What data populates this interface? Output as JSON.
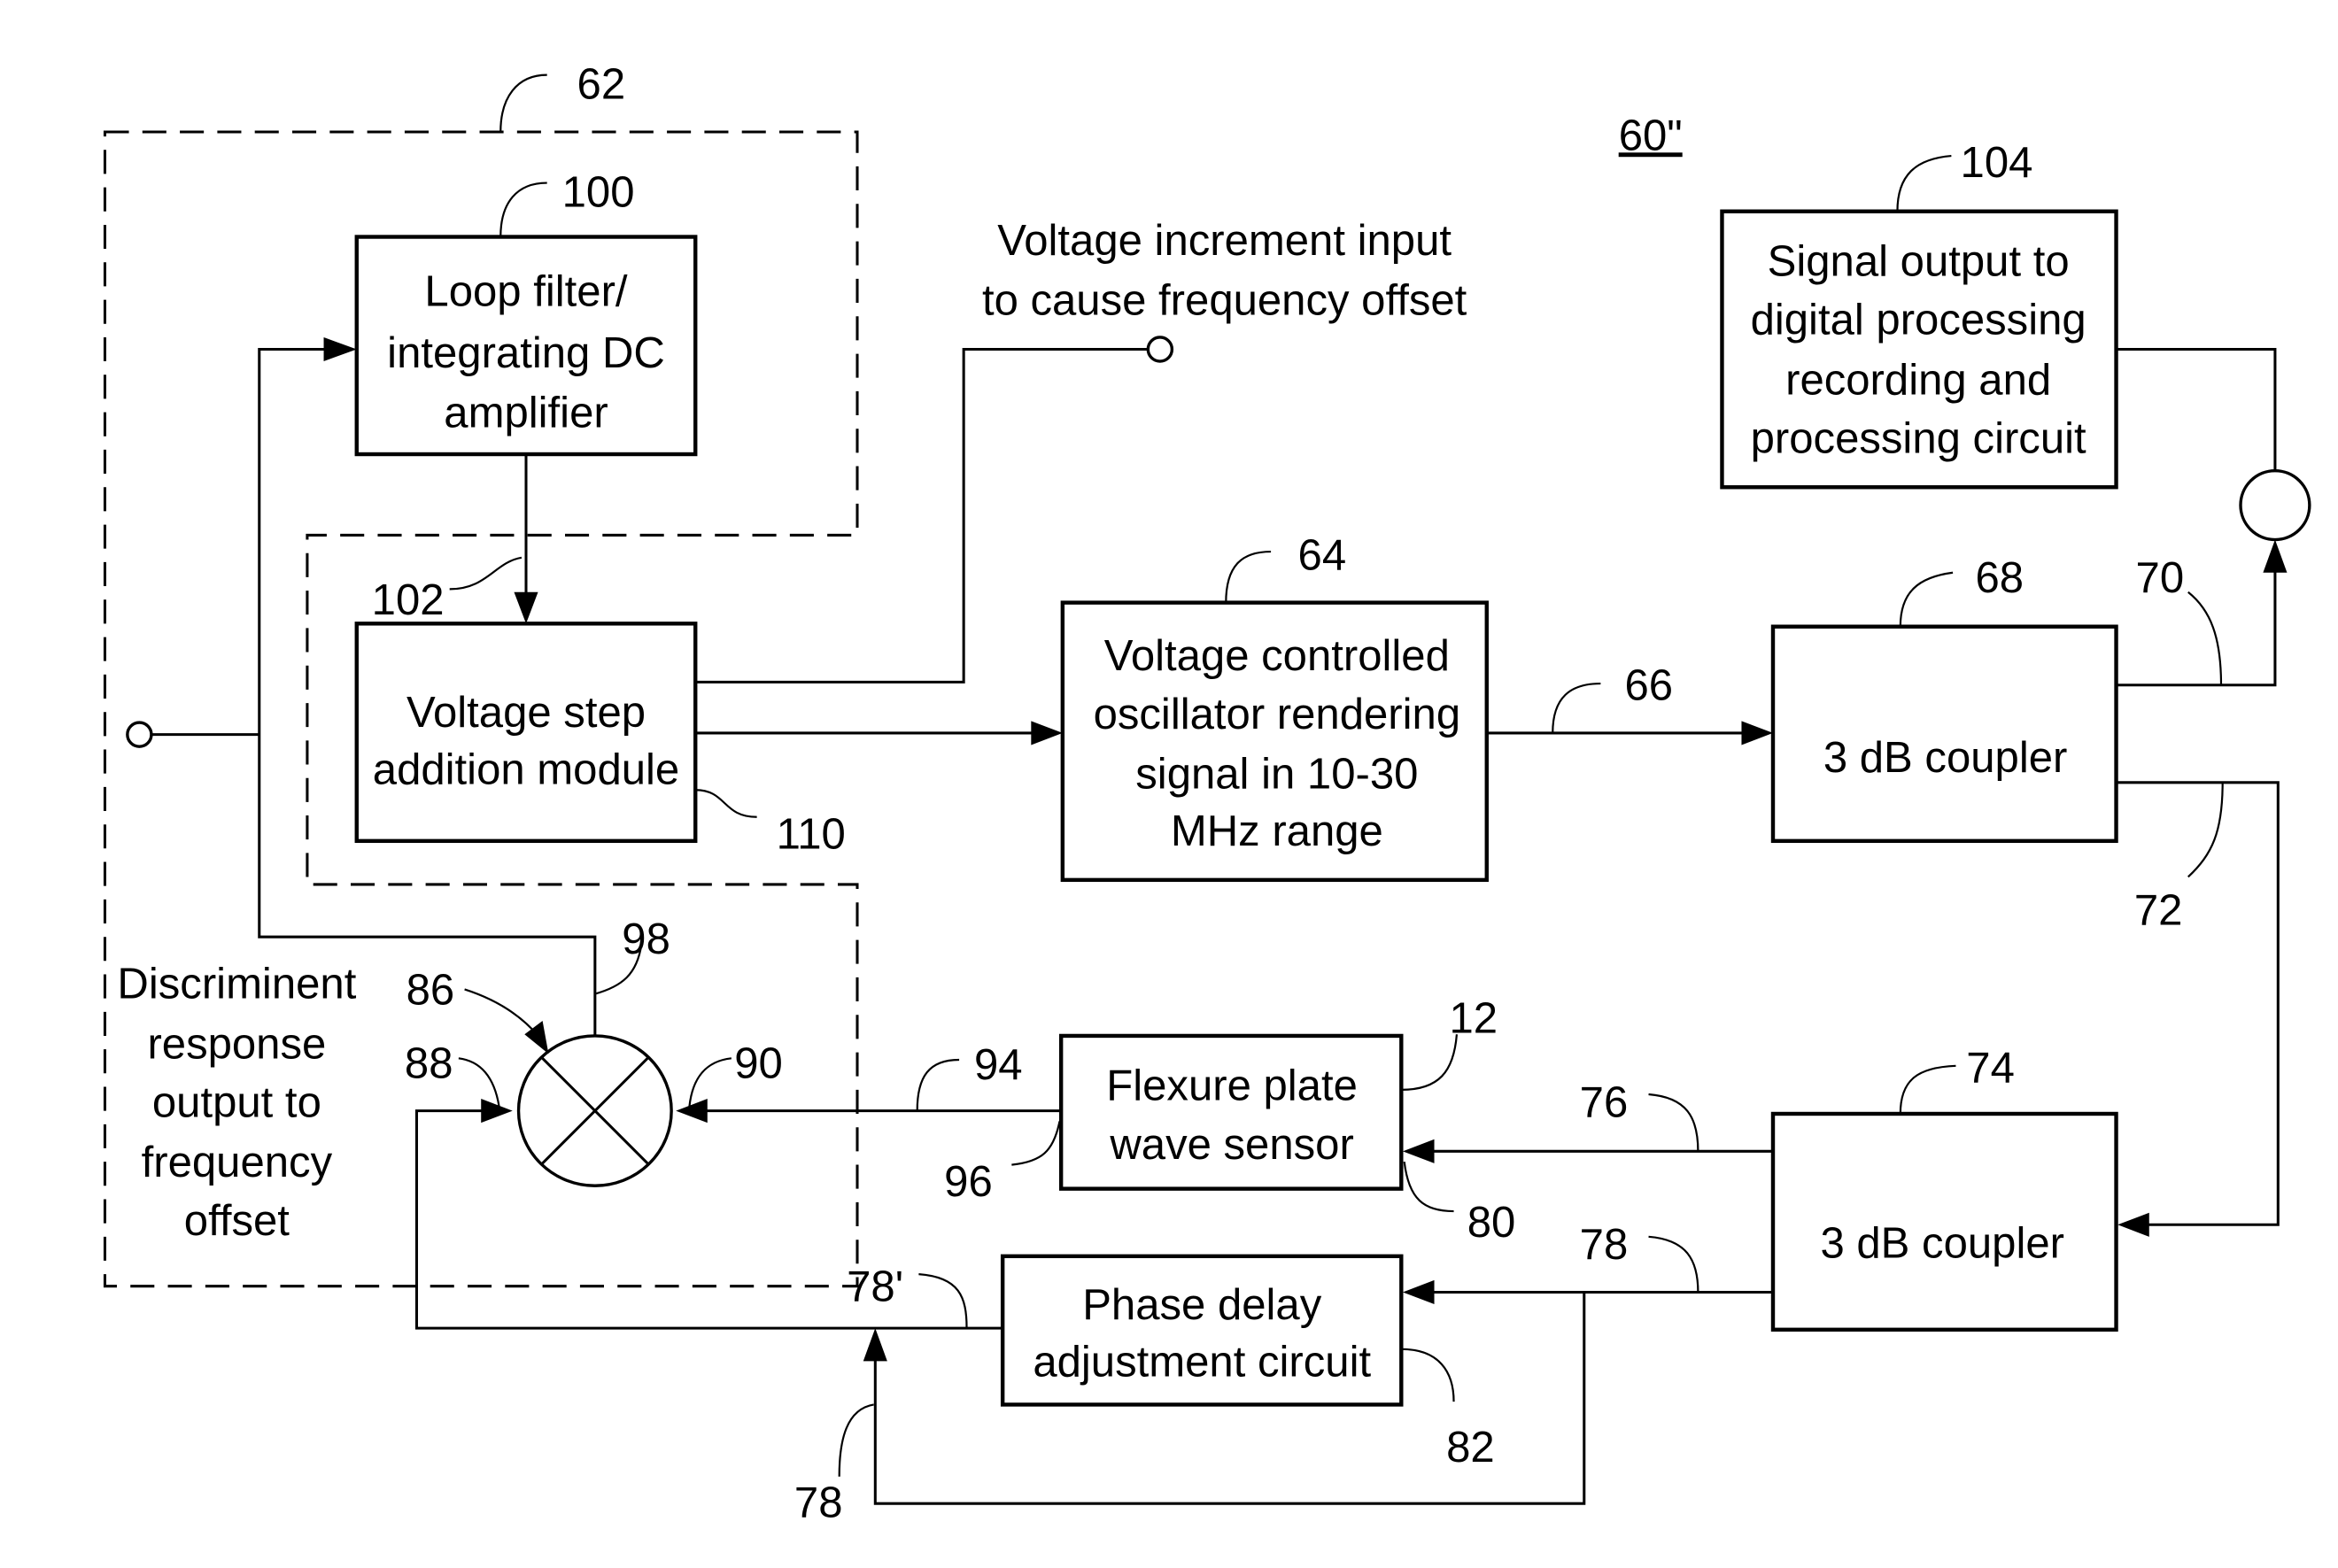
{
  "figure": {
    "figure_id": "60\"",
    "type": "block-diagram"
  },
  "blocks": {
    "loop_filter": {
      "ref": "100",
      "lines": [
        "Loop filter/",
        "integrating DC",
        "amplifier"
      ]
    },
    "voltage_step": {
      "ref": "102",
      "ref_side": "110",
      "lines": [
        "Voltage step",
        "addition module"
      ]
    },
    "vco": {
      "ref": "64",
      "lines": [
        "Voltage controlled",
        "oscillator rendering",
        "signal in 10-30",
        "MHz range"
      ]
    },
    "signal_output": {
      "ref": "104",
      "lines": [
        "Signal output to",
        "digital processing",
        "recording and",
        "processing circuit"
      ]
    },
    "coupler_top": {
      "ref": "68",
      "lines": [
        "3 dB coupler"
      ]
    },
    "coupler_bottom": {
      "ref": "74",
      "lines": [
        "3 dB coupler"
      ]
    },
    "flexure_sensor": {
      "ref": "12",
      "lines": [
        "Flexure plate",
        "wave sensor"
      ]
    },
    "phase_delay": {
      "ref": "82",
      "lines": [
        "Phase delay",
        "adjustment circuit"
      ]
    }
  },
  "annotations": {
    "voltage_increment": [
      "Voltage increment input",
      "to cause frequency offset"
    ],
    "discriminent": [
      "Discriminent",
      "response",
      "output to",
      "frequency",
      "offset"
    ]
  },
  "groups": {
    "discriminator_group": {
      "ref": "62"
    }
  },
  "mixer": {
    "ref": "98",
    "input_refs": [
      "86",
      "88",
      "90"
    ]
  },
  "signal_refs": {
    "vco_to_coupler": "66",
    "coupler_out_top": "70",
    "coupler_out_bottom": "72",
    "to_sensor": "76",
    "to_phase_delay": "78",
    "sensor_input": "80",
    "sensor_out": "94",
    "sensor_out_port": "96",
    "phase_out": "78'",
    "bypass": "78"
  }
}
